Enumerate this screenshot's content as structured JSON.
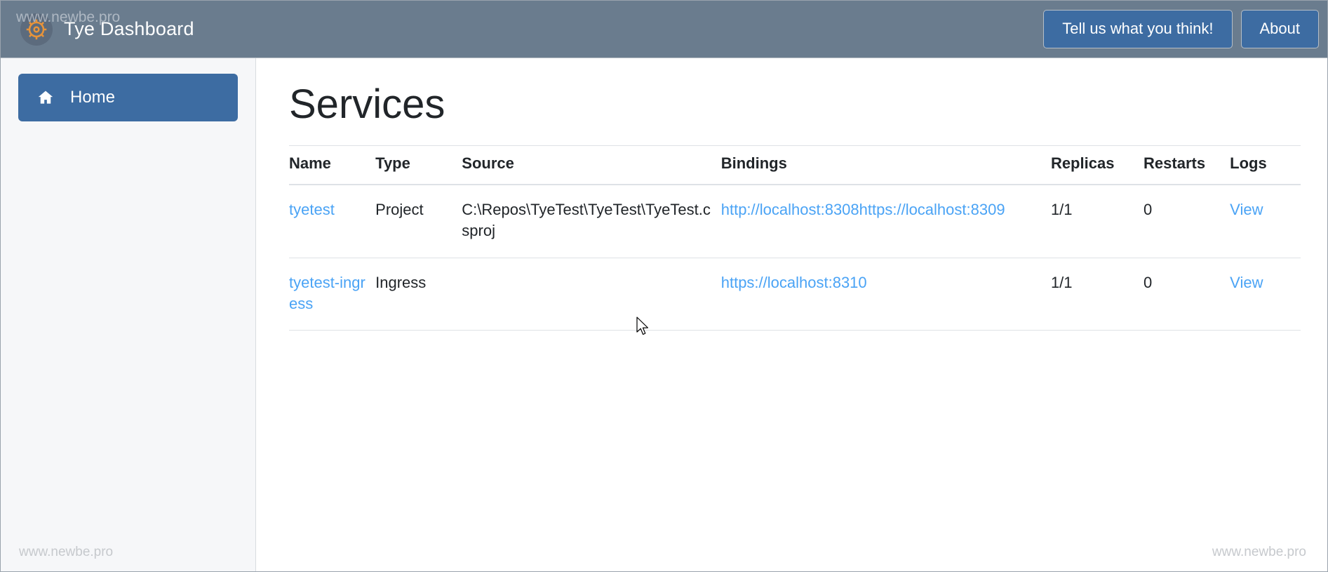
{
  "header": {
    "logo_icon": "ship-wheel-icon",
    "title": "Tye Dashboard",
    "feedback_button": "Tell us what you think!",
    "about_button": "About",
    "watermark": "www.newbe.pro",
    "background_color": "#6a7c8e",
    "button_color": "#3d6ca2"
  },
  "sidebar": {
    "items": [
      {
        "label": "Home",
        "icon": "home-icon",
        "active": true
      }
    ],
    "watermark": "www.newbe.pro",
    "active_color": "#3d6ca2",
    "background_color": "#f6f7f9"
  },
  "main": {
    "page_title": "Services",
    "watermark": "www.newbe.pro",
    "link_color": "#4aa3f5",
    "table": {
      "columns": [
        "Name",
        "Type",
        "Source",
        "Bindings",
        "Replicas",
        "Restarts",
        "Logs"
      ],
      "rows": [
        {
          "name": "tyetest",
          "type": "Project",
          "source": "C:\\Repos\\TyeTest\\TyeTest\\TyeTest.csproj",
          "bindings": [
            "http://localhost:8308",
            "https://localhost:8309"
          ],
          "replicas": "1/1",
          "restarts": "0",
          "logs": "View"
        },
        {
          "name": "tyetest-ingress",
          "type": "Ingress",
          "source": "",
          "bindings": [
            "https://localhost:8310"
          ],
          "replicas": "1/1",
          "restarts": "0",
          "logs": "View"
        }
      ]
    }
  }
}
